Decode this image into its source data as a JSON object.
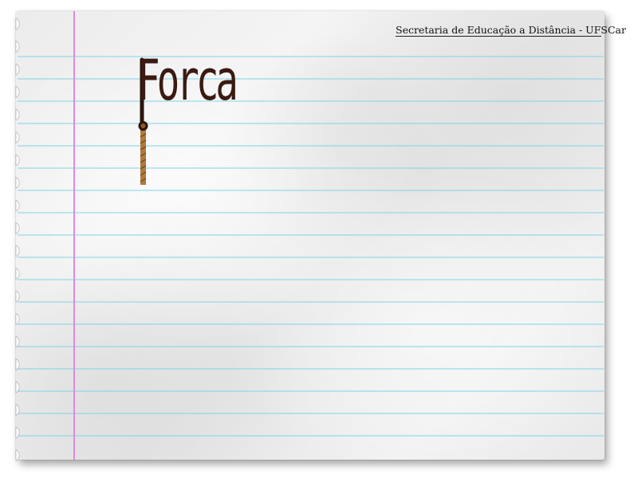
{
  "page": {
    "header_text": "Secretaria de Educação a Distância - UFSCar",
    "title": "Forca"
  },
  "colors": {
    "paper_base": "#eeeeee",
    "ruled_line": "#7fd3e6",
    "margin_line": "#e08ad8",
    "title_color": "#3a1a12",
    "rope_color": "#b07a3c"
  },
  "icons": {
    "rope": "hanging-rope-icon",
    "spiral": "notebook-spiral-holes"
  }
}
